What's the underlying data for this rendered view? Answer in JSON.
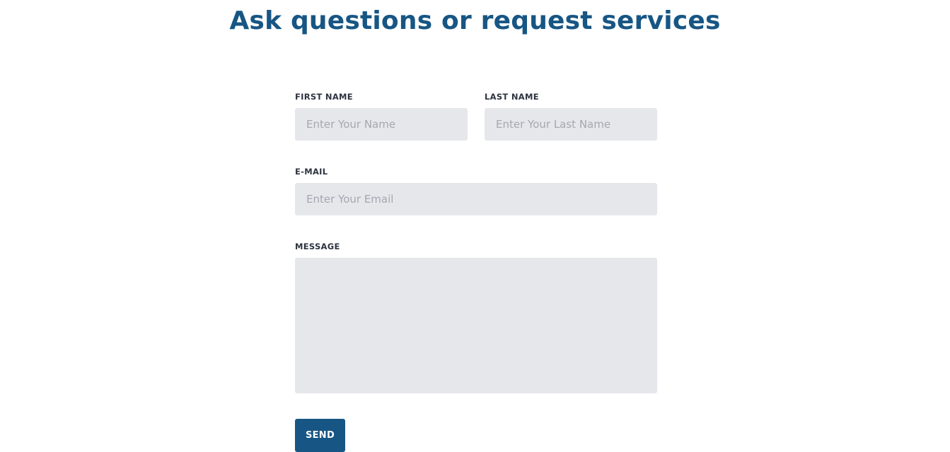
{
  "page": {
    "title": "Ask questions or request services"
  },
  "form": {
    "first_name": {
      "label": "FIRST NAME",
      "placeholder": "Enter Your Name",
      "value": ""
    },
    "last_name": {
      "label": "LAST NAME",
      "placeholder": "Enter Your Last Name",
      "value": ""
    },
    "email": {
      "label": "E-MAIL",
      "placeholder": "Enter Your Email",
      "value": ""
    },
    "message": {
      "label": "MESSAGE",
      "value": ""
    },
    "send_label": "SEND"
  },
  "colors": {
    "title": "#175684",
    "button_background": "#175684",
    "button_text": "#ffffff",
    "input_background": "#e5e7eb",
    "label_text": "#2e3440",
    "placeholder_text": "#a3a8b1"
  }
}
